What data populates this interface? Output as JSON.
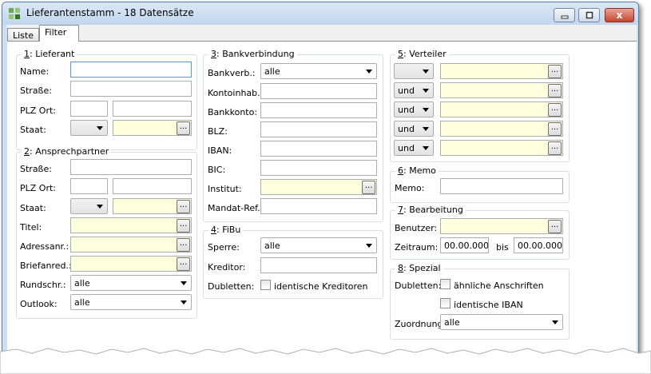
{
  "window": {
    "title": "Lieferantenstamm - 18 Datensätze",
    "close_glyph": "x"
  },
  "tabs": [
    {
      "label": "Liste",
      "active": false
    },
    {
      "label": "Filter",
      "active": true
    }
  ],
  "lieferant": {
    "legend_num": "1",
    "legend_text": ": Lieferant",
    "name_label": "Name:",
    "strasse_label": "Straße:",
    "plz_label": "PLZ Ort:",
    "staat_label": "Staat:"
  },
  "ansprechpartner": {
    "legend_num": "2",
    "legend_text": ": Ansprechpartner",
    "strasse_label": "Straße:",
    "plz_label": "PLZ Ort:",
    "staat_label": "Staat:",
    "titel_label": "Titel:",
    "adressanr_label": "Adressanr.:",
    "briefanred_label": "Briefanred.:",
    "rundschr_label": "Rundschr.:",
    "rundschr_value": "alle",
    "outlook_label": "Outlook:",
    "outlook_value": "alle"
  },
  "bankverbindung": {
    "legend_num": "3",
    "legend_text": ": Bankverbindung",
    "bankverb_label": "Bankverb.:",
    "bankverb_value": "alle",
    "kontoinhab_label": "Kontoinhab.:",
    "bankkonto_label": "Bankkonto:",
    "blz_label": "BLZ:",
    "iban_label": "IBAN:",
    "bic_label": "BIC:",
    "institut_label": "Institut:",
    "mandat_label": "Mandat-Ref.:"
  },
  "fibu": {
    "legend_num": "4",
    "legend_text": ": FiBu",
    "sperre_label": "Sperre:",
    "sperre_value": "alle",
    "kreditor_label": "Kreditor:",
    "dubletten_label": "Dubletten:",
    "dubletten_cb": "identische Kreditoren"
  },
  "verteiler": {
    "legend_num": "5",
    "legend_text": ": Verteiler",
    "rows": [
      {
        "op": ""
      },
      {
        "op": "und"
      },
      {
        "op": "und"
      },
      {
        "op": "und"
      },
      {
        "op": "und"
      }
    ]
  },
  "memo": {
    "legend_num": "6",
    "legend_text": ": Memo",
    "memo_label": "Memo:"
  },
  "bearbeitung": {
    "legend_num": "7",
    "legend_text": ": Bearbeitung",
    "benutzer_label": "Benutzer:",
    "zeitraum_label": "Zeitraum:",
    "date_from": "00.00.0000",
    "bis_label": "bis",
    "date_to": "00.00.0000"
  },
  "spezial": {
    "legend_num": "8",
    "legend_text": ": Spezial",
    "dubletten_label": "Dubletten:",
    "cb1": "ähnliche Anschriften",
    "cb2": "identische IBAN",
    "zuordnung_label": "Zuordnung:",
    "zuordnung_value": "alle"
  },
  "browse_label": "..."
}
